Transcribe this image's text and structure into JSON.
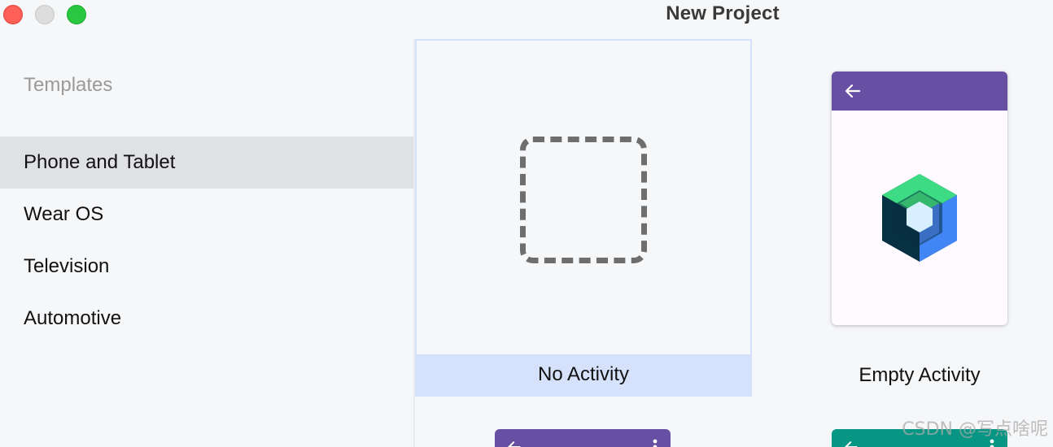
{
  "window": {
    "title": "New Project"
  },
  "colors": {
    "close": "#fe5f57",
    "minimize": "#dddddd",
    "maximize": "#28c840",
    "selection": "#d6e2fb",
    "purple_appbar": "#6750a4",
    "teal_appbar": "#079683"
  },
  "sidebar": {
    "heading": "Templates",
    "items": [
      {
        "label": "Phone and Tablet",
        "selected": true
      },
      {
        "label": "Wear OS",
        "selected": false
      },
      {
        "label": "Television",
        "selected": false
      },
      {
        "label": "Automotive",
        "selected": false
      }
    ]
  },
  "templates": [
    {
      "label": "No Activity",
      "selected": true,
      "icon": "dashed-square-icon"
    },
    {
      "label": "Empty Activity",
      "selected": false,
      "icon": "jetpack-compose-icon"
    }
  ],
  "watermark": "CSDN @写点啥呢"
}
